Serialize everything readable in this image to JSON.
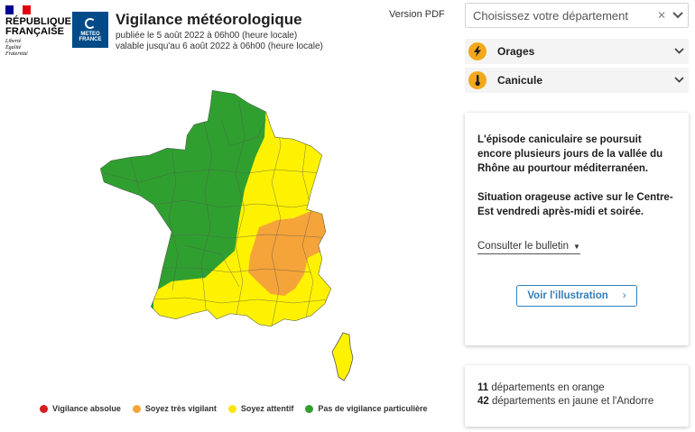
{
  "header": {
    "rf_name_line1": "RÉPUBLIQUE",
    "rf_name_line2": "FRANÇAISE",
    "rf_motto": "Liberté\nÉgalité\nFraternité",
    "mf_name": "METEO\nFRANCE",
    "title": "Vigilance météorologique",
    "published": "publiée le 5 août 2022 à 06h00 (heure locale)",
    "valid_until": "valable jusqu'au 6 août 2022 à 06h00 (heure locale)",
    "pdf_label": "Version PDF"
  },
  "department_select": {
    "placeholder": "Choisissez votre département",
    "clear_icon": "✕",
    "chevron_icon": "⌄"
  },
  "phenomena": [
    {
      "label": "Orages",
      "icon": "lightning-icon",
      "color": "#f2a81d"
    },
    {
      "label": "Canicule",
      "icon": "thermometer-icon",
      "color": "#f2a81d"
    }
  ],
  "bulletin": {
    "paragraph1": "L'épisode caniculaire se poursuit encore plusieurs jours de la vallée du Rhône au pourtour méditerranéen.",
    "paragraph2": "Situation orageuse active sur le Centre-Est vendredi après-midi et soirée.",
    "consult_label": "Consulter le bulletin",
    "illustration_button": "Voir l'illustration",
    "illustration_arrow": "›"
  },
  "stats": {
    "orange_count": "11",
    "orange_text": "départements en orange",
    "yellow_count": "42",
    "yellow_text": "départements en jaune et l'Andorre"
  },
  "legend": [
    {
      "label": "Vigilance absolue",
      "color": "#d21f1f"
    },
    {
      "label": "Soyez très vigilant",
      "color": "#f5a43a"
    },
    {
      "label": "Soyez attentif",
      "color": "#ffe600"
    },
    {
      "label": "Pas de vigilance particulière",
      "color": "#2fa02f"
    }
  ],
  "map_colors": {
    "green": "#2fa02f",
    "yellow": "#fff200",
    "orange": "#f5a43a",
    "border": "#555555"
  }
}
